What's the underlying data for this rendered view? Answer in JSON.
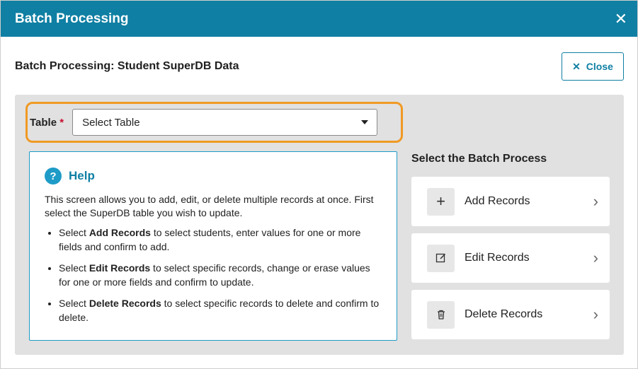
{
  "modal": {
    "title": "Batch Processing"
  },
  "subheader": {
    "title": "Batch Processing: Student SuperDB Data",
    "close_label": "Close"
  },
  "table_field": {
    "label": "Table",
    "required_mark": "*",
    "selected": "Select Table"
  },
  "help": {
    "title": "Help",
    "intro": "This screen allows you to add, edit, or delete multiple records at once. First select the SuperDB table you wish to update.",
    "items": [
      {
        "bold": "Add Records",
        "text_before": "Select ",
        "text_after": " to select students, enter values for one or more fields and confirm to add."
      },
      {
        "bold": "Edit Records",
        "text_before": "Select ",
        "text_after": " to select specific records, change or erase values for one or more fields and confirm to update."
      },
      {
        "bold": "Delete Records",
        "text_before": "Select ",
        "text_after": " to select specific records to delete and confirm to delete."
      }
    ]
  },
  "batch": {
    "title": "Select the Batch Process",
    "actions": [
      {
        "label": "Add Records",
        "icon": "plus-icon"
      },
      {
        "label": "Edit Records",
        "icon": "edit-icon"
      },
      {
        "label": "Delete Records",
        "icon": "trash-icon"
      }
    ]
  },
  "colors": {
    "header": "#0f7fa3",
    "highlight": "#f09a24",
    "panel": "#e1e1e1"
  }
}
